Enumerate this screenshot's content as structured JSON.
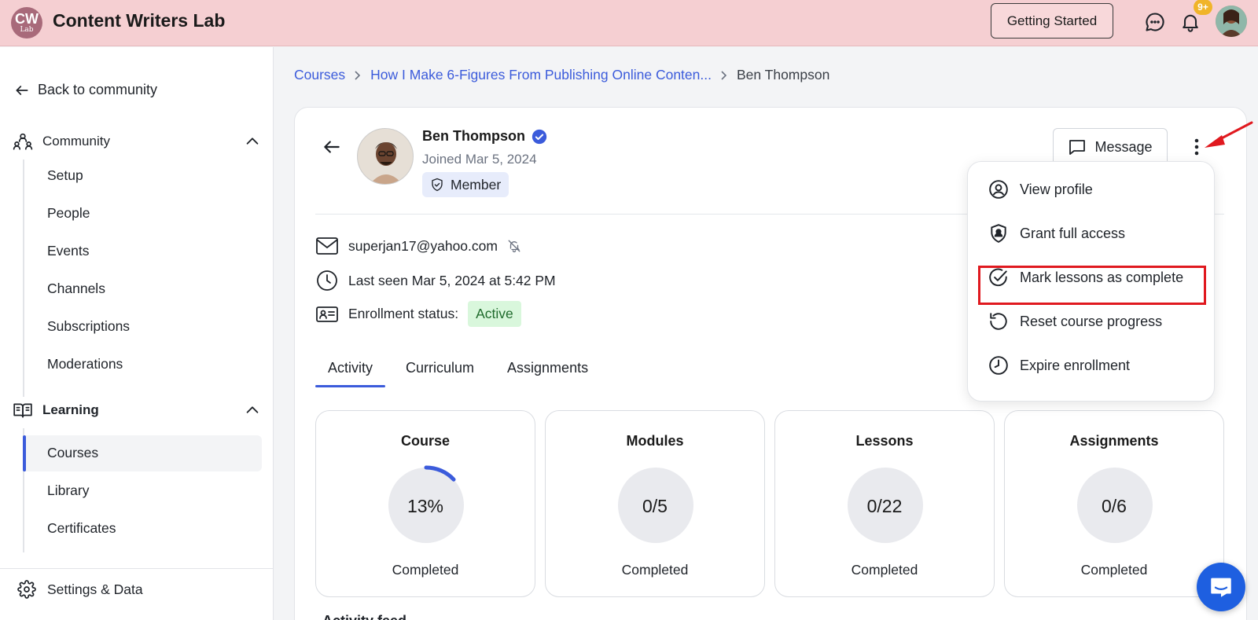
{
  "app": {
    "logo_line1": "CW",
    "logo_line2": "Lab",
    "title": "Content Writers Lab",
    "getting_started": "Getting Started",
    "notification_count": "9+"
  },
  "sidebar": {
    "back_label": "Back to community",
    "community": {
      "label": "Community",
      "items": [
        "Setup",
        "People",
        "Events",
        "Channels",
        "Subscriptions",
        "Moderations"
      ]
    },
    "learning": {
      "label": "Learning",
      "items": [
        "Courses",
        "Library",
        "Certificates"
      ],
      "active": "Courses"
    },
    "settings_label": "Settings & Data"
  },
  "breadcrumb": {
    "items": [
      "Courses",
      "How I Make 6-Figures From Publishing Online Conten..."
    ],
    "current": "Ben Thompson"
  },
  "member": {
    "name": "Ben Thompson",
    "joined": "Joined Mar 5, 2024",
    "role": "Member",
    "email": "superjan17@yahoo.com",
    "last_seen": "Last seen Mar 5, 2024 at 5:42 PM",
    "enrollment_label": "Enrollment status:",
    "enrollment_status": "Active",
    "message_label": "Message"
  },
  "tabs": [
    "Activity",
    "Curriculum",
    "Assignments"
  ],
  "active_tab": "Activity",
  "stats": [
    {
      "title": "Course",
      "value": "13%",
      "label": "Completed",
      "progress": 0.13
    },
    {
      "title": "Modules",
      "value": "0/5",
      "label": "Completed",
      "progress": 0
    },
    {
      "title": "Lessons",
      "value": "0/22",
      "label": "Completed",
      "progress": 0
    },
    {
      "title": "Assignments",
      "value": "0/6",
      "label": "Completed",
      "progress": 0
    }
  ],
  "feed_title": "Activity feed",
  "menu": {
    "items": [
      "View profile",
      "Grant full access",
      "Mark lessons as complete",
      "Reset course progress",
      "Expire enrollment"
    ],
    "highlighted": "Mark lessons as complete"
  },
  "colors": {
    "accent": "#3b5bdb",
    "topbar": "#f5cfd2",
    "highlight": "#e0191f",
    "active_pill": "#d9f7dc"
  }
}
